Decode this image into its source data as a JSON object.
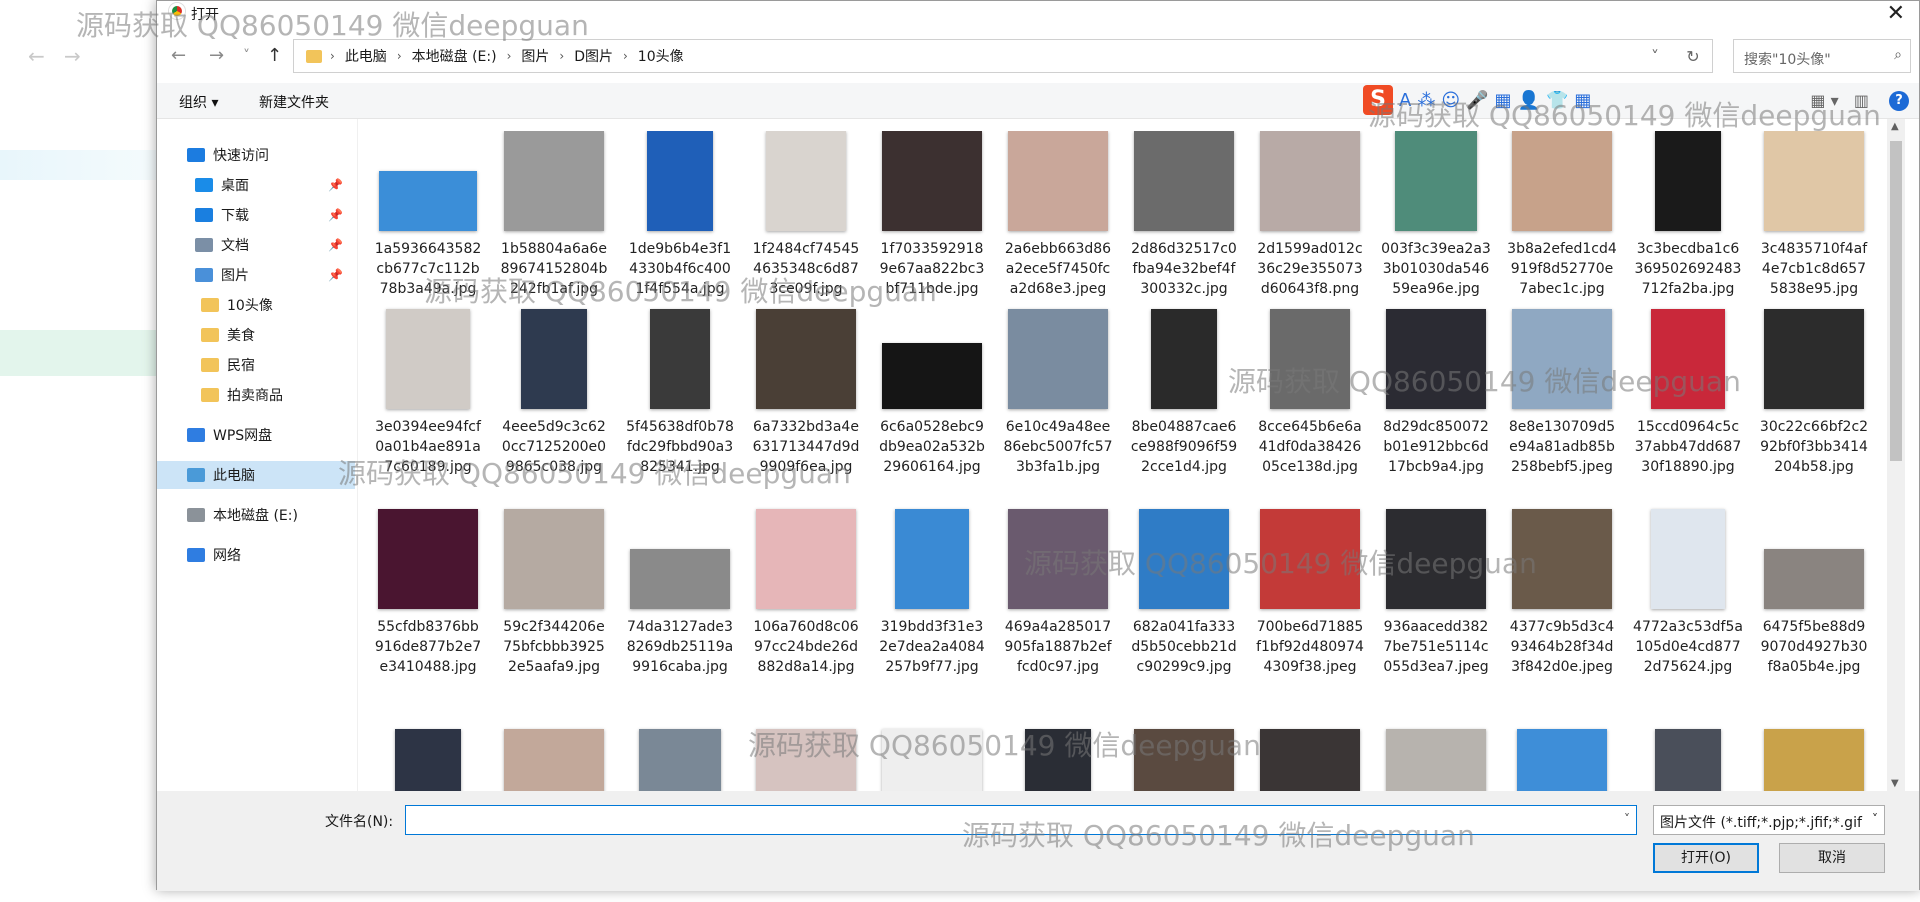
{
  "dialog": {
    "title": "打开",
    "close_glyph": "✕"
  },
  "nav": {
    "back": "←",
    "forward": "→",
    "recent": "˅",
    "up": "↑",
    "breadcrumb": [
      "此电脑",
      "本地磁盘 (E:)",
      "图片",
      "D图片",
      "10头像"
    ],
    "refresh": "↻",
    "dropdown": "˅",
    "search_placeholder": "搜索\"10头像\""
  },
  "toolbar": {
    "organize": "组织 ▾",
    "new_folder": "新建文件夹"
  },
  "sidebar": [
    {
      "label": "快速访问",
      "icon": "star-icon",
      "color": "#1c7ce0",
      "pinned": false,
      "selected": false
    },
    {
      "label": "桌面",
      "icon": "desktop-icon",
      "color": "#1a8ce8",
      "pinned": true,
      "selected": false
    },
    {
      "label": "下载",
      "icon": "download-icon",
      "color": "#1a7fe0",
      "pinned": true,
      "selected": false
    },
    {
      "label": "文档",
      "icon": "document-icon",
      "color": "#7b8fa6",
      "pinned": true,
      "selected": false
    },
    {
      "label": "图片",
      "icon": "pictures-icon",
      "color": "#4a90d9",
      "pinned": true,
      "selected": false
    },
    {
      "label": "10头像",
      "icon": "folder-icon",
      "color": "#f2c45a",
      "pinned": false,
      "selected": false
    },
    {
      "label": "美食",
      "icon": "folder-icon",
      "color": "#f2c45a",
      "pinned": false,
      "selected": false
    },
    {
      "label": "民宿",
      "icon": "folder-icon",
      "color": "#f2c45a",
      "pinned": false,
      "selected": false
    },
    {
      "label": "拍卖商品",
      "icon": "folder-icon",
      "color": "#f2c45a",
      "pinned": false,
      "selected": false
    },
    {
      "label": "WPS网盘",
      "icon": "cloud-icon",
      "color": "#2f7de1",
      "pinned": false,
      "selected": false
    },
    {
      "label": "此电脑",
      "icon": "computer-icon",
      "color": "#4a9ad8",
      "pinned": false,
      "selected": true
    },
    {
      "label": "本地磁盘 (E:)",
      "icon": "drive-icon",
      "color": "#8b9299",
      "pinned": false,
      "selected": false
    },
    {
      "label": "网络",
      "icon": "network-icon",
      "color": "#2f7de1",
      "pinned": false,
      "selected": false
    }
  ],
  "pin_glyph": "📌",
  "files": [
    {
      "name": "1a5936643582cb677c7c112b78b3a49a.jpg",
      "color": "#3b8ed8"
    },
    {
      "name": "1b58804a6a6e89674152804b242fb1af.jpg",
      "color": "#9a9a9a"
    },
    {
      "name": "1de9b6b4e3f14330b4f6c4001f4f554a.jpg",
      "color": "#1f5fb8"
    },
    {
      "name": "1f2484cf745454635348c6d873ce09f.jpg",
      "color": "#d9d4cf"
    },
    {
      "name": "1f70335929189e67aa822bc3bf711bde.jpg",
      "color": "#3c3030"
    },
    {
      "name": "2a6ebb663d86a2ece5f7450fca2d68e3.jpeg",
      "color": "#c9a79a"
    },
    {
      "name": "2d86d32517c0fba94e32bef4f300332c.jpg",
      "color": "#6b6b6b"
    },
    {
      "name": "2d1599ad012c36c29e355073d60643f8.png",
      "color": "#b8aaa6"
    },
    {
      "name": "003f3c39ea2a33b01030da54659ea96e.jpg",
      "color": "#4f8c7a"
    },
    {
      "name": "3b8a2efed1cd4919f8d52770e7abec1c.jpg",
      "color": "#c7a28a"
    },
    {
      "name": "3c3becdba1c6369502692483712fa2ba.jpg",
      "color": "#1a1a1a"
    },
    {
      "name": "3c4835710f4af4e7cb1c8d6575838e95.jpg",
      "color": "#e0c7a6"
    },
    {
      "name": "3e0394ee94fcf0a01b4ae891a7c60189.jpg",
      "color": "#d0cbc6"
    },
    {
      "name": "4eee5d9c3c620cc7125200e09865c038.jpg",
      "color": "#2e3a4f"
    },
    {
      "name": "5f45638df0b78fdc29fbbd90a3825341.jpg",
      "color": "#3a3a3a"
    },
    {
      "name": "6a7332bd3a4e631713447d9d9909f6ea.jpg",
      "color": "#4a3f36"
    },
    {
      "name": "6c6a0528ebc9db9ea02a532b29606164.jpg",
      "color": "#151515"
    },
    {
      "name": "6e10c49a48ee86ebc5007fc573b3fa1b.jpg",
      "color": "#7a8ca0"
    },
    {
      "name": "8be04887cae6ce988f9096f592cce1d4.jpg",
      "color": "#2a2a2a"
    },
    {
      "name": "8cce645b6e6a41df0da3842605ce138d.jpg",
      "color": "#6a6a6a"
    },
    {
      "name": "8d29dc850072b01e912bbc6d17bcb9a4.jpg",
      "color": "#2b2b33"
    },
    {
      "name": "8e8e130709d5e94a81adb85b258bebf5.jpeg",
      "color": "#8fa8c2"
    },
    {
      "name": "15ccd0964c5c37abb47dd68730f18890.jpg",
      "color": "#c9283a"
    },
    {
      "name": "30c22c66bf2c292bf0f3bb3414204b58.jpg",
      "color": "#2c2c2c"
    },
    {
      "name": "55cfdb8376bb916de877b2e7e3410488.jpg",
      "color": "#4a1530"
    },
    {
      "name": "59c2f344206e75bfcbbb39252e5aafa9.jpg",
      "color": "#b5aaa2"
    },
    {
      "name": "74da3127ade38269db25119a9916caba.jpg",
      "color": "#8a8a8a"
    },
    {
      "name": "106a760d8c0697cc24bde26d882d8a14.jpg",
      "color": "#e6b6b8"
    },
    {
      "name": "319bdd3f31e32e7dea2a4084257b9f77.jpg",
      "color": "#3a8ad4"
    },
    {
      "name": "469a4a285017905fa1887b2effcd0c97.jpg",
      "color": "#6a5a6e"
    },
    {
      "name": "682a041fa333d5b50cebb21dc90299c9.jpg",
      "color": "#2f7cc6"
    },
    {
      "name": "700be6d71885f1bf92d4809744309f38.jpeg",
      "color": "#c33a38"
    },
    {
      "name": "936aacedd3827be751e5114c055d3ea7.jpeg",
      "color": "#2c2c30"
    },
    {
      "name": "4377c9b5d3c493464b28f34d3f842d0e.jpeg",
      "color": "#6a5a4a"
    },
    {
      "name": "4772a3c53df5a105d0e4cd8772d75624.jpg",
      "color": "#dfe6ee"
    },
    {
      "name": "6475f5be88d99070d4927b30f8a05b4e.jpg",
      "color": "#8a8480"
    },
    {
      "name": "",
      "color": "#2d3445"
    },
    {
      "name": "",
      "color": "#c2a89a"
    },
    {
      "name": "",
      "color": "#7a8896"
    },
    {
      "name": "",
      "color": "#d6c3c0"
    },
    {
      "name": "",
      "color": "#eeeeee"
    },
    {
      "name": "",
      "color": "#2a2d35"
    },
    {
      "name": "",
      "color": "#5a4a40"
    },
    {
      "name": "",
      "color": "#3a3535"
    },
    {
      "name": "",
      "color": "#b7b3ae"
    },
    {
      "name": "",
      "color": "#3e8ed8"
    },
    {
      "name": "",
      "color": "#4a4f5a"
    },
    {
      "name": "",
      "color": "#c9a24a"
    }
  ],
  "bottom": {
    "filename_label": "文件名(N):",
    "filename_value": "",
    "filter": "图片文件 (*.tiff;*.pjp;*.jfif;*.gif",
    "open": "打开(O)",
    "cancel": "取消"
  },
  "ime_glyphs": [
    "S",
    "A",
    "⁂",
    "☺",
    "🎤",
    "▦",
    "👤",
    "👕",
    "▦"
  ],
  "watermark": "源码获取 QQ86050149 微信deepguan"
}
